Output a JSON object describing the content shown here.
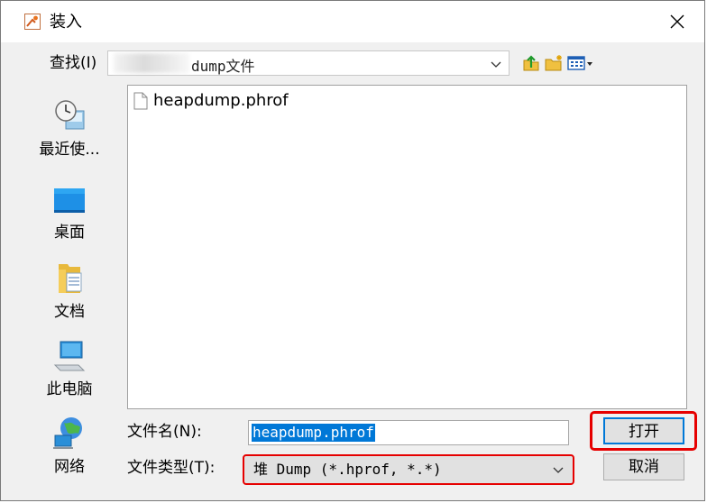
{
  "window": {
    "title": "装入",
    "close_glyph": "✕"
  },
  "lookin": {
    "label": "查找(I)",
    "value": "dump文件"
  },
  "toolbar": {
    "icons": [
      "up-one-level-icon",
      "new-folder-icon",
      "list-view-icon"
    ]
  },
  "sidebar": {
    "items": [
      {
        "label": "最近使...",
        "icon": "recent-items-icon"
      },
      {
        "label": "桌面",
        "icon": "desktop-icon"
      },
      {
        "label": "文档",
        "icon": "documents-folder-icon"
      },
      {
        "label": "此电脑",
        "icon": "computer-icon"
      },
      {
        "label": "网络",
        "icon": "network-icon"
      }
    ]
  },
  "files": [
    {
      "name": "heapdump.phrof",
      "icon": "file-icon"
    }
  ],
  "filename": {
    "label": "文件名(N):",
    "value": "heapdump.phrof"
  },
  "filetype": {
    "label": "文件类型(T):",
    "value": "堆 Dump (*.hprof, *.*)"
  },
  "buttons": {
    "open": "打开",
    "cancel": "取消"
  },
  "colors": {
    "selection": "#0078d7",
    "highlight": "#e60000",
    "accent": "#0078d7"
  }
}
